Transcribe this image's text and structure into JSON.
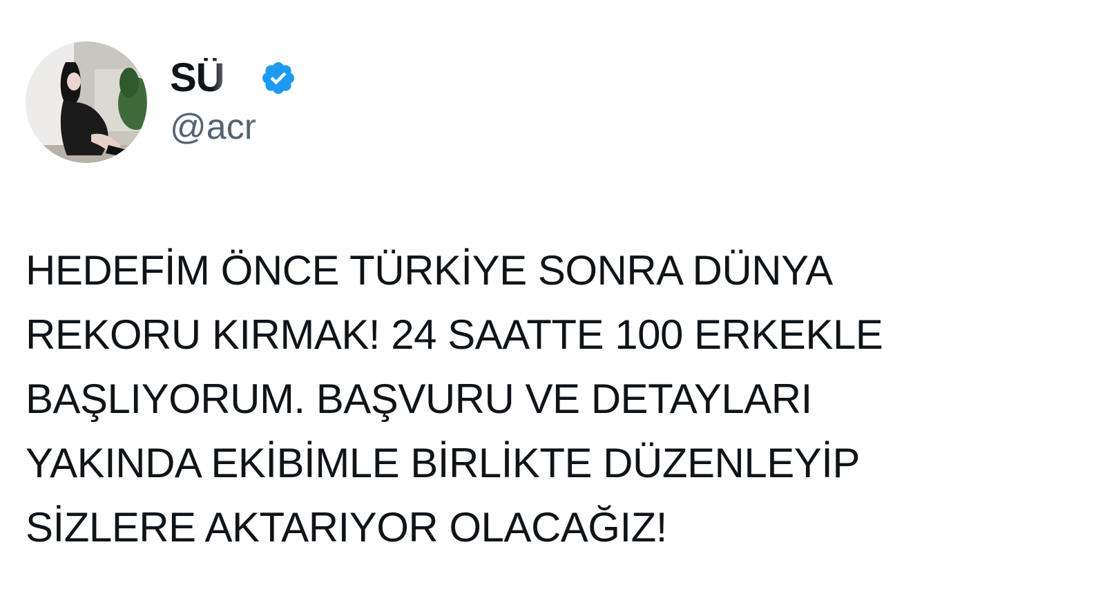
{
  "tweet": {
    "author": {
      "display_name": "SÜ",
      "handle": "@acr",
      "verified": true,
      "avatar_icon": "profile-photo-avatar"
    },
    "text_lines": [
      "HEDEFİM ÖNCE TÜRKİYE SONRA DÜNYA",
      "REKORU KIRMAK! 24 SAATTE 100 ERKEKLE",
      "BAŞLIYORUM. BAŞVURU VE DETAYLARI",
      "YAKINDA EKİBİMLE BİRLİKTE DÜZENLEYİP",
      "SİZLERE AKTARIYOR OLACAĞIZ!"
    ]
  },
  "colors": {
    "background": "#ffffff",
    "text_primary": "#0f1419",
    "text_secondary": "#536471",
    "verified_blue": "#1d9bf0"
  }
}
